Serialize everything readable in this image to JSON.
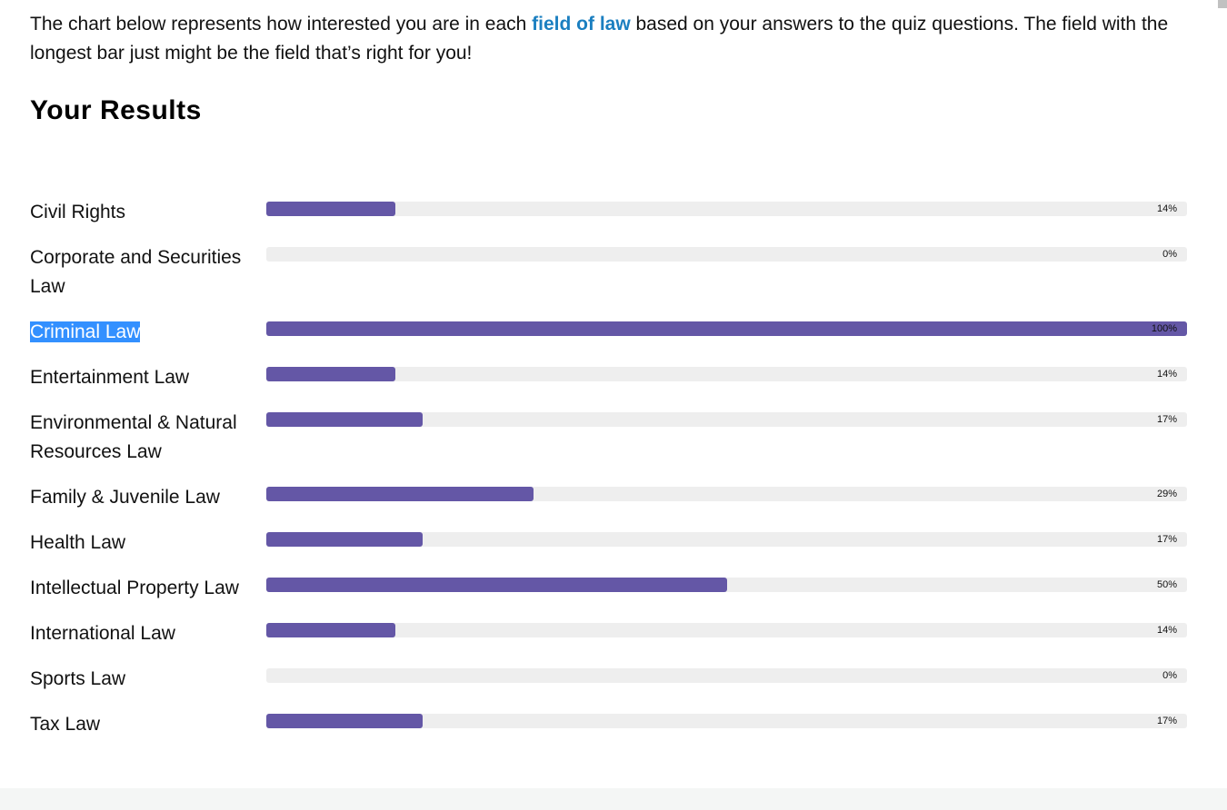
{
  "intro": {
    "before": "The chart below represents how interested you are in each ",
    "link": "field of law",
    "after": " based on your answers to the quiz questions. The field with the longest bar just might be the field that’s right for you!"
  },
  "heading": "Your Results",
  "colors": {
    "bar": "#6457a6",
    "track": "#eeeeee",
    "link": "#1b7fc0",
    "selection": "#3390ff"
  },
  "chart_data": {
    "type": "bar",
    "orientation": "horizontal",
    "xlim": [
      0,
      100
    ],
    "categories": [
      "Civil Rights",
      "Corporate and Securities Law",
      "Criminal Law",
      "Entertainment Law",
      "Environmental & Natural Resources Law",
      "Family & Juvenile Law",
      "Health Law",
      "Intellectual Property Law",
      "International Law",
      "Sports Law",
      "Tax Law"
    ],
    "values": [
      14,
      0,
      100,
      14,
      17,
      29,
      17,
      50,
      14,
      0,
      17
    ],
    "value_labels": [
      "14%",
      "0%",
      "100%",
      "14%",
      "17%",
      "29%",
      "17%",
      "50%",
      "14%",
      "0%",
      "17%"
    ],
    "selected_category": "Criminal Law"
  }
}
